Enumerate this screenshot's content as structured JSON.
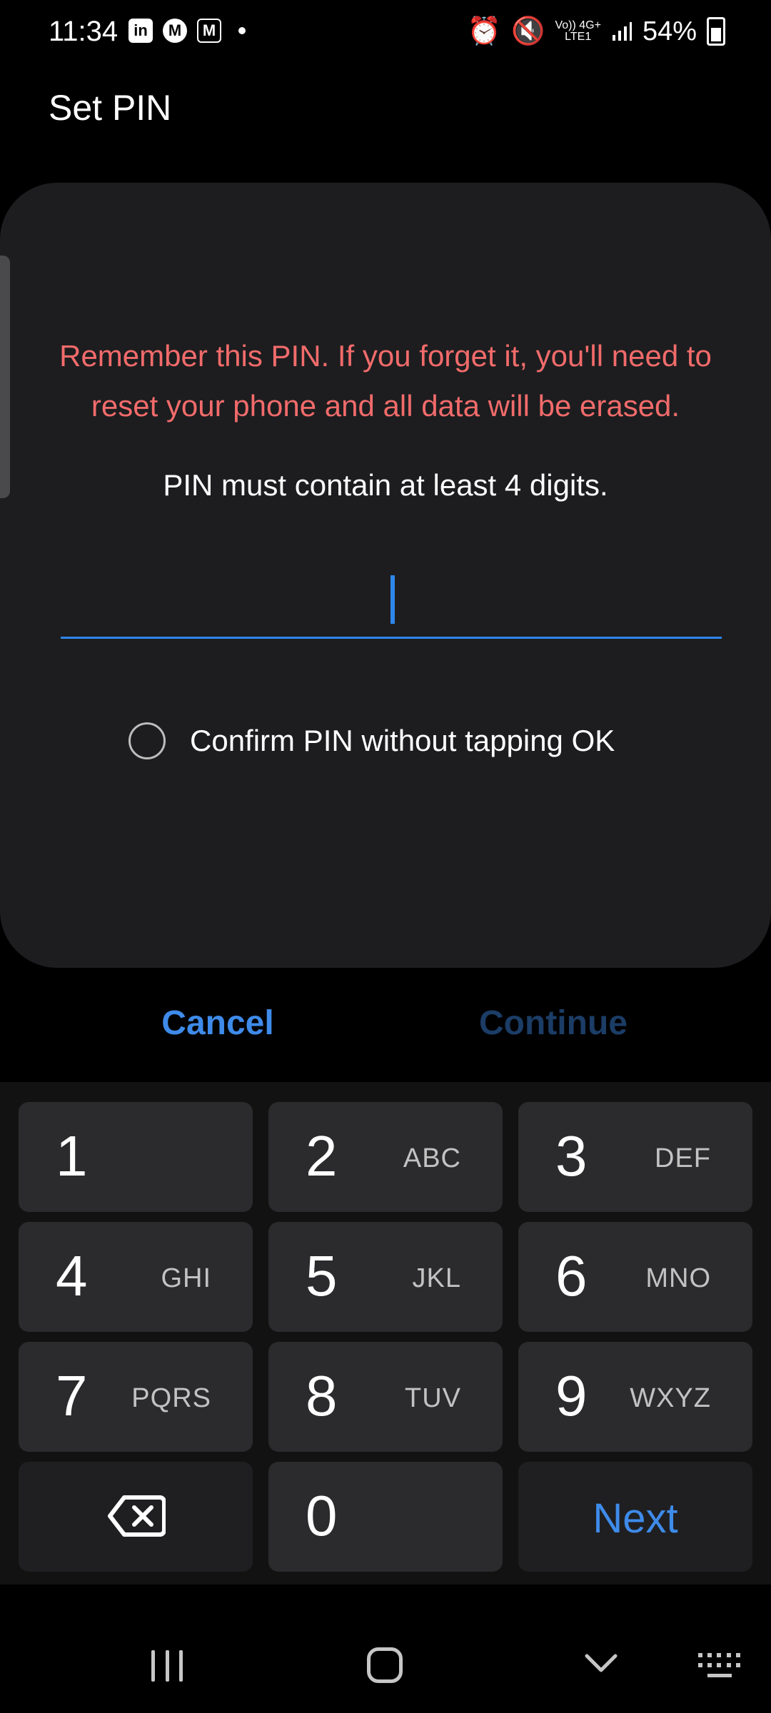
{
  "status_bar": {
    "time": "11:34",
    "notification_icons": [
      "linkedin-icon",
      "mastodon-icon",
      "gmail-icon"
    ],
    "net_label_top": "Vo)) 4G+",
    "net_label_bottom": "LTE1",
    "battery": "54%"
  },
  "header": {
    "title": "Set PIN"
  },
  "dialog": {
    "warning": "Remember this PIN. If you forget it, you'll need to reset your phone and all data will be erased.",
    "hint": "PIN must contain at least 4 digits.",
    "pin_value": "",
    "confirm_option": {
      "label": "Confirm PIN without tapping OK",
      "checked": false
    }
  },
  "actions": {
    "cancel": "Cancel",
    "continue": "Continue"
  },
  "keypad": {
    "keys": [
      {
        "digit": "1",
        "letters": ""
      },
      {
        "digit": "2",
        "letters": "ABC"
      },
      {
        "digit": "3",
        "letters": "DEF"
      },
      {
        "digit": "4",
        "letters": "GHI"
      },
      {
        "digit": "5",
        "letters": "JKL"
      },
      {
        "digit": "6",
        "letters": "MNO"
      },
      {
        "digit": "7",
        "letters": "PQRS"
      },
      {
        "digit": "8",
        "letters": "TUV"
      },
      {
        "digit": "9",
        "letters": "WXYZ"
      },
      {
        "digit": "0",
        "letters": ""
      }
    ],
    "next_label": "Next"
  },
  "colors": {
    "accent": "#3e8bea",
    "warning": "#f26b6b",
    "disabled_action": "#1b3d66"
  }
}
